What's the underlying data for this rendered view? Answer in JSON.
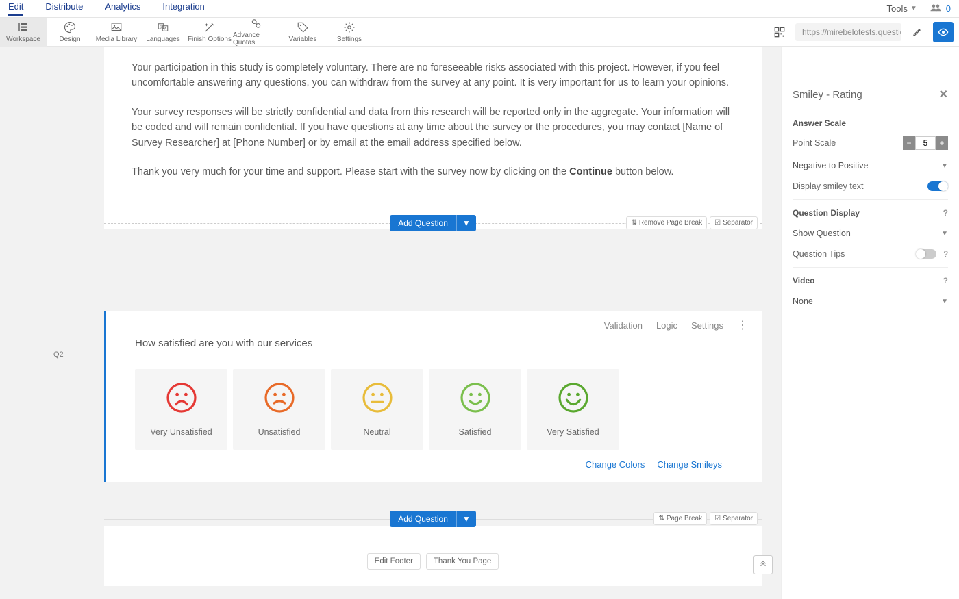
{
  "topnav": {
    "items": [
      "Edit",
      "Distribute",
      "Analytics",
      "Integration"
    ],
    "tools": "Tools",
    "count": "0"
  },
  "toolbar": {
    "items": [
      "Workspace",
      "Design",
      "Media Library",
      "Languages",
      "Finish Options",
      "Advance Quotas",
      "Variables",
      "Settings"
    ],
    "url": "https://mirebelotests.questionpro.co"
  },
  "intro": {
    "p1": "Your participation in this study is completely voluntary. There are no foreseeable risks associated with this project. However, if you feel uncomfortable answering any questions, you can withdraw from the survey at any point. It is very important for us to learn your opinions.",
    "p2": "Your survey responses will be strictly confidential and data from this research will be reported only in the aggregate. Your information will be coded and will remain confidential. If you have questions at any time about the survey or the procedures, you may contact [Name of Survey Researcher] at [Phone Number] or by email at the email address specified below.",
    "p3a": "Thank you very much for your time and support. Please start with the survey now by clicking on the ",
    "p3b": "Continue",
    "p3c": " button below."
  },
  "add": {
    "label": "Add Question",
    "remove_pb": "Remove Page Break",
    "page_break": "Page Break",
    "separator": "Separator"
  },
  "q2": {
    "num": "Q2",
    "tools": {
      "validation": "Validation",
      "logic": "Logic",
      "settings": "Settings"
    },
    "title": "How satisfied are you with our services",
    "options": [
      "Very Unsatisfied",
      "Unsatisfied",
      "Neutral",
      "Satisfied",
      "Very Satisfied"
    ],
    "colors": [
      "#e53935",
      "#e86a28",
      "#e8bc3a",
      "#7bbf4d",
      "#5aa82f"
    ],
    "links": {
      "colors": "Change Colors",
      "smileys": "Change Smileys"
    }
  },
  "footer": {
    "edit": "Edit Footer",
    "thank": "Thank You Page"
  },
  "side": {
    "title": "Smiley - Rating",
    "answer_scale": "Answer Scale",
    "point_scale": "Point Scale",
    "point_value": "5",
    "direction": "Negative to Positive",
    "display_text": "Display smiley text",
    "question_display": "Question Display",
    "show_question": "Show Question",
    "question_tips": "Question Tips",
    "video": "Video",
    "video_val": "None"
  }
}
